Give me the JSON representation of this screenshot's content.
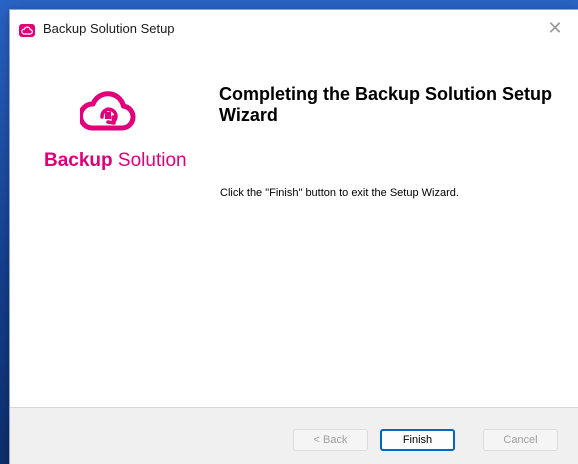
{
  "window": {
    "title": "Backup Solution Setup",
    "close_glyph": "✕"
  },
  "brand": {
    "color": "#e2007a",
    "logo_icon": "cloud-backup-icon",
    "name_bold": "Backup",
    "name_regular": "Solution"
  },
  "main": {
    "heading": "Completing the Backup Solution Setup Wizard",
    "message": "Click the \"Finish\" button to exit the Setup Wizard."
  },
  "footer": {
    "back_label": "< Back",
    "finish_label": "Finish",
    "cancel_label": "Cancel"
  }
}
